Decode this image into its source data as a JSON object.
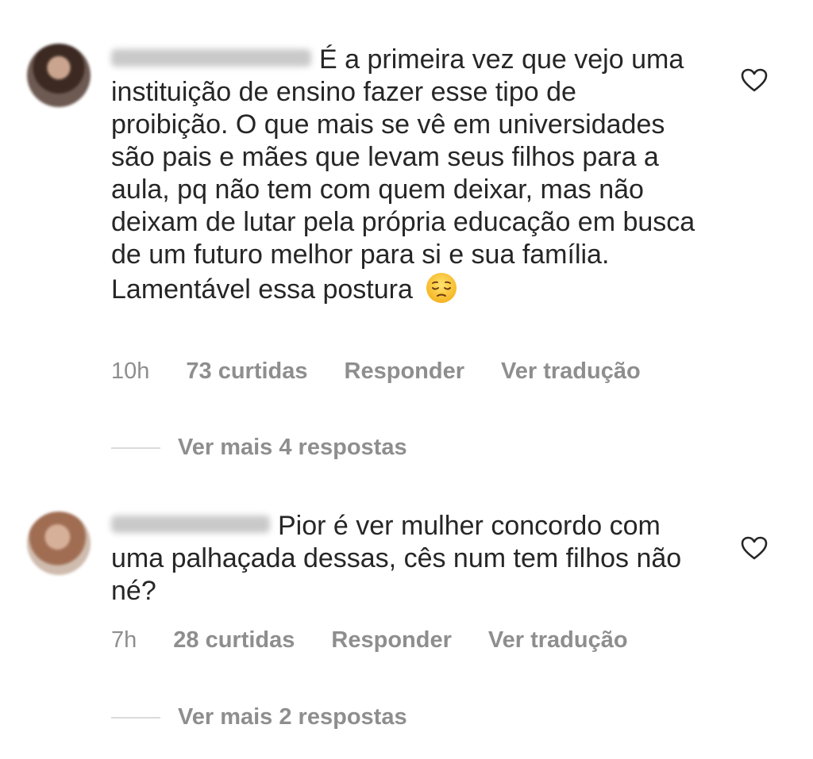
{
  "comments": [
    {
      "text_line1": "É a primeira vez que vejo",
      "text_rest": "uma instituição de ensino fazer esse tipo de proibição. O que mais se vê em universidades são pais e mães que levam seus filhos para a aula, pq não tem com quem deixar, mas não deixam de lutar pela própria educação em busca de um futuro melhor para si e sua família. Lamentável essa postura",
      "emoji": "pensive-face",
      "time": "10h",
      "likes": "73 curtidas",
      "reply": "Responder",
      "translate": "Ver tradução",
      "more_replies": "Ver mais 4 respostas"
    },
    {
      "text_line1": "Pior é ver mulher concordo",
      "text_rest": "com uma palhaçada dessas, cês num tem filhos não né?",
      "time": "7h",
      "likes": "28 curtidas",
      "reply": "Responder",
      "translate": "Ver tradução",
      "more_replies": "Ver mais 2 respostas"
    }
  ],
  "icons": {
    "like": "heart-outline-icon"
  },
  "colors": {
    "text": "#262626",
    "secondary": "#8e8e8e",
    "divider": "#dbdbdb"
  }
}
